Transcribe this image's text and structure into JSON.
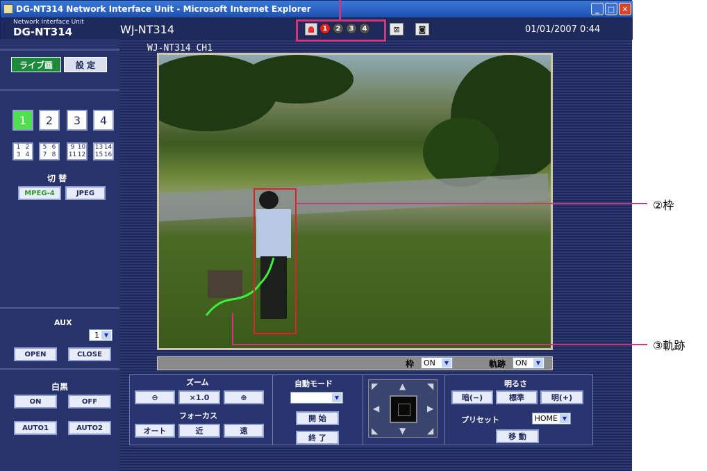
{
  "window": {
    "title": "DG-NT314 Network Interface Unit - Microsoft Internet Explorer",
    "minimize": "_",
    "restore": "□",
    "close": "✕"
  },
  "header": {
    "brand_small": "Network Interface Unit",
    "brand_big": "DG-NT314",
    "device_name": "WJ-NT314",
    "alarm_dots": [
      "1",
      "2",
      "3",
      "4"
    ],
    "datetime": "01/01/2007  0:44"
  },
  "sidebar": {
    "tab_live": "ライブ画",
    "tab_setup": "設 定",
    "channels": [
      "1",
      "2",
      "3",
      "4"
    ],
    "quads": [
      [
        "1",
        "2",
        "3",
        "4"
      ],
      [
        "5",
        "6",
        "7",
        "8"
      ],
      [
        "9",
        "10",
        "11",
        "12"
      ],
      [
        "13",
        "14",
        "15",
        "16"
      ]
    ],
    "switch_label": "切 替",
    "format_mpeg4": "MPEG-4",
    "format_jpeg": "JPEG",
    "aux_label": "AUX",
    "aux_select": "1",
    "aux_open": "OPEN",
    "aux_close": "CLOSE",
    "bw_label": "白黒",
    "bw_on": "ON",
    "bw_off": "OFF",
    "bw_auto1": "AUTO1",
    "bw_auto2": "AUTO2"
  },
  "main": {
    "camera_title": "WJ-NT314  CH1",
    "frame_label": "枠",
    "frame_value": "ON",
    "trail_label": "軌跡",
    "trail_value": "ON"
  },
  "controls": {
    "zoom_title": "ズーム",
    "zoom_out": "⊖",
    "zoom_reset": "×1.0",
    "zoom_in": "⊕",
    "focus_title": "フォーカス",
    "focus_auto": "オート",
    "focus_near": "近",
    "focus_far": "遠",
    "auto_mode_title": "自動モード",
    "auto_mode_value": "",
    "start": "開 始",
    "stop": "終 了",
    "brightness_title": "明るさ",
    "bright_dark": "暗(−)",
    "bright_std": "標準",
    "bright_light": "明(+)",
    "preset_title": "プリセット",
    "preset_value": "HOME",
    "move": "移 動"
  },
  "annotations": {
    "frame": "②枠",
    "trail": "③軌跡"
  }
}
